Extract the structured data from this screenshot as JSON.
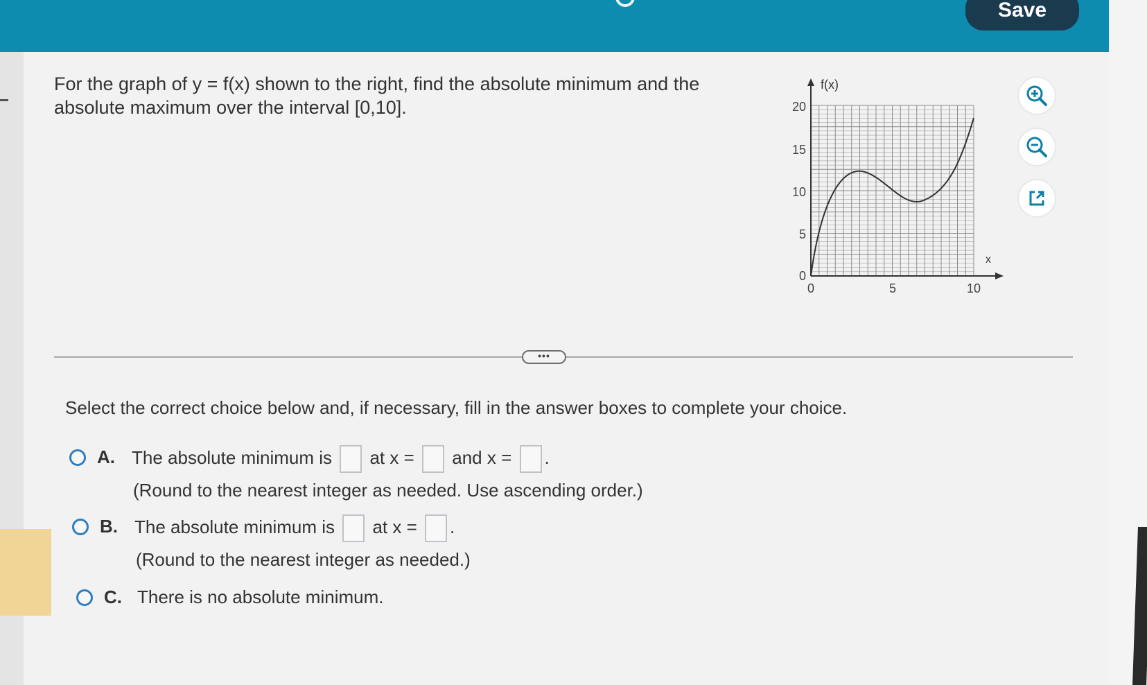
{
  "header": {
    "save_label": "Save"
  },
  "question": {
    "text": "For the graph of y = f(x) shown to the right, find the absolute minimum and the absolute maximum over the interval [0,10]."
  },
  "graph": {
    "y_axis_label": "f(x)",
    "x_axis_label": "x",
    "y_ticks": [
      "0",
      "5",
      "10",
      "15",
      "20"
    ],
    "x_ticks": [
      "0",
      "5",
      "10"
    ]
  },
  "side_icons": [
    "zoom-in-icon",
    "zoom-out-icon",
    "popout-icon"
  ],
  "instructions": "Select the correct choice below and, if necessary, fill in the answer boxes to complete your choice.",
  "more_label": "•••",
  "choices": {
    "a": {
      "letter": "A.",
      "text1": "The absolute minimum is",
      "text2": "at x =",
      "text3": "and x =",
      "text4": ".",
      "note": "(Round to the nearest integer as needed. Use ascending order.)"
    },
    "b": {
      "letter": "B.",
      "text1": "The absolute minimum is",
      "text2": "at x =",
      "text3": ".",
      "note": "(Round to the nearest integer as needed.)"
    },
    "c": {
      "letter": "C.",
      "text1": "There is no absolute minimum."
    }
  },
  "colors": {
    "header_bg": "#0d8cb0",
    "save_bg": "#1a3a4e",
    "radio_border": "#2e7fbf"
  }
}
